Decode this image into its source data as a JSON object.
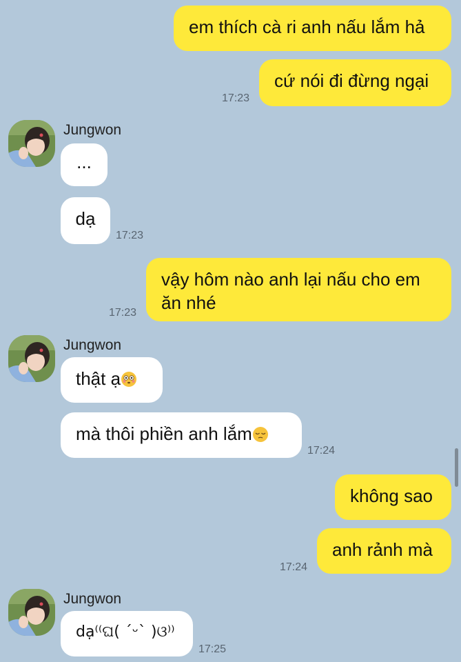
{
  "messages": [
    {
      "text": "em thích cà ri anh nấu lắm hả"
    },
    {
      "text": "cứ nói đi đừng ngại",
      "time": "17:23"
    },
    {
      "sender": "Jungwon",
      "text": "..."
    },
    {
      "text": "dạ",
      "time": "17:23"
    },
    {
      "text": "vậy hôm nào anh lại nấu cho em ăn nhé",
      "time": "17:23"
    },
    {
      "sender": "Jungwon",
      "text": "thật ạ"
    },
    {
      "text": "mà thôi phiền anh lắm",
      "time": "17:24"
    },
    {
      "text": "không sao"
    },
    {
      "text": "anh rảnh mà",
      "time": "17:24"
    },
    {
      "sender": "Jungwon",
      "text": "dạ⁽⁽ଘ( ˊᵕˋ )ଓ⁾⁾",
      "time": "17:25"
    }
  ],
  "icons": {
    "emoji_1": "flushed-face-icon",
    "emoji_2": "pensive-face-icon",
    "avatar": "avatar-photo"
  },
  "colors": {
    "background": "#b3c8da",
    "outgoing_bubble": "#fee93a",
    "incoming_bubble": "#ffffff"
  }
}
